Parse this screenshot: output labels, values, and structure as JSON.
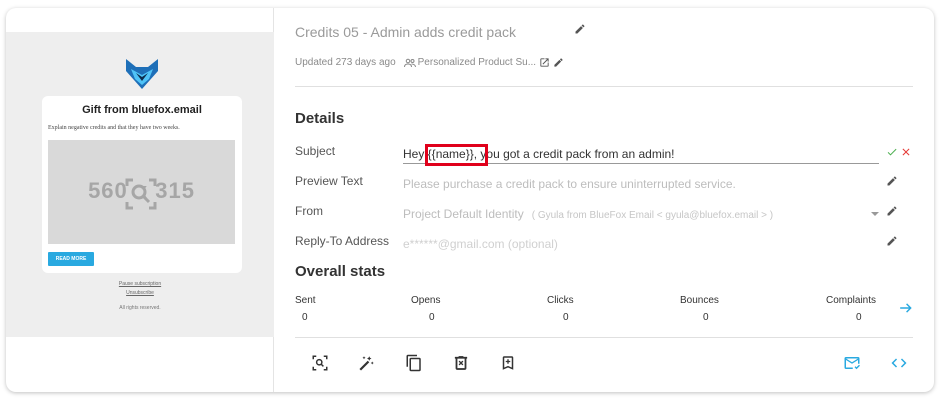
{
  "preview": {
    "email_title": "Gift from bluefox.email",
    "email_text": "Explain negative credits and that they have two weeks.",
    "image_placeholder": "560 x 315",
    "read_more": "READ MORE",
    "footer_link_1": "Pause subscription",
    "footer_link_2": "Unsubscribe",
    "footer_rights": "All rights reserved."
  },
  "header": {
    "title": "Credits 05 - Admin adds credit pack",
    "updated": "Updated 273 days ago",
    "project": "Personalized Product Su..."
  },
  "details": {
    "heading": "Details",
    "subject_label": "Subject",
    "subject_value": "Hey {{name}}, you got a credit pack from an admin!",
    "preview_label": "Preview Text",
    "preview_value": "Please purchase a credit pack to ensure uninterrupted service.",
    "from_label": "From",
    "from_value": "Project Default Identity",
    "from_extra": "( Gyula from BlueFox Email < gyula@bluefox.email > )",
    "reply_label": "Reply-To Address",
    "reply_placeholder": "e******@gmail.com (optional)"
  },
  "stats": {
    "heading": "Overall stats",
    "sent_label": "Sent",
    "sent_value": "0",
    "opens_label": "Opens",
    "opens_value": "0",
    "clicks_label": "Clicks",
    "clicks_value": "0",
    "bounces_label": "Bounces",
    "bounces_value": "0",
    "complaints_label": "Complaints",
    "complaints_value": "0"
  },
  "colors": {
    "accent": "#29a9e0",
    "confirm": "#4caf50",
    "cancel": "#e53935",
    "highlight": "#e0001b"
  },
  "icons": [
    "pencil-icon",
    "group-icon",
    "open-external-icon",
    "check-icon",
    "close-icon",
    "chevron-down-icon",
    "arrow-right-icon",
    "zoom-icon",
    "magic-wand-icon",
    "copy-icon",
    "delete-icon",
    "bookmark-add-icon",
    "send-test-email-icon",
    "code-icon"
  ]
}
